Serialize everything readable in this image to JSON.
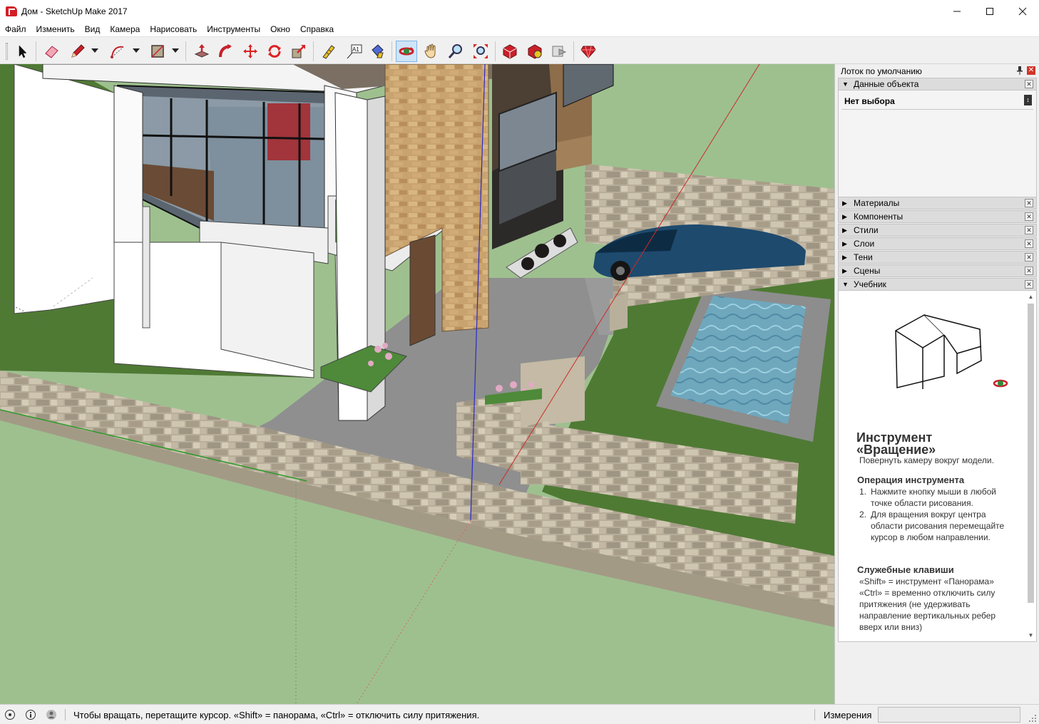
{
  "window": {
    "title": "Дом - SketchUp Make 2017",
    "minimize_symbol": "—",
    "maximize_symbol": "☐",
    "close_symbol": "✕"
  },
  "menu": [
    "Файл",
    "Изменить",
    "Вид",
    "Камера",
    "Нарисовать",
    "Инструменты",
    "Окно",
    "Справка"
  ],
  "toolbar": {
    "tools": [
      {
        "name": "select-tool",
        "icon": "arrow-cursor-icon"
      },
      {
        "name": "eraser-tool",
        "icon": "eraser-icon"
      },
      {
        "name": "line-tool",
        "icon": "pencil-icon"
      },
      {
        "name": "arc-tool",
        "icon": "arc-icon"
      },
      {
        "name": "shape-tool",
        "icon": "rectangle-icon"
      },
      {
        "name": "push-pull-tool",
        "icon": "push-pull-icon"
      },
      {
        "name": "follow-me-tool",
        "icon": "follow-me-icon"
      },
      {
        "name": "move-tool",
        "icon": "move-icon"
      },
      {
        "name": "rotate-tool",
        "icon": "rotate-icon"
      },
      {
        "name": "scale-tool",
        "icon": "scale-icon"
      },
      {
        "name": "tape-measure-tool",
        "icon": "tape-measure-icon"
      },
      {
        "name": "text-tool",
        "icon": "text-icon"
      },
      {
        "name": "paint-bucket-tool",
        "icon": "paint-bucket-icon"
      },
      {
        "name": "orbit-tool",
        "icon": "orbit-icon",
        "active": true
      },
      {
        "name": "pan-tool",
        "icon": "hand-icon"
      },
      {
        "name": "zoom-tool",
        "icon": "magnifier-icon"
      },
      {
        "name": "zoom-extents-tool",
        "icon": "zoom-extents-icon"
      },
      {
        "name": "3d-warehouse-button",
        "icon": "warehouse-icon"
      },
      {
        "name": "extension-warehouse-button",
        "icon": "extension-icon"
      },
      {
        "name": "send-to-layout-button",
        "icon": "layout-icon"
      },
      {
        "name": "ruby-console-button",
        "icon": "ruby-icon"
      }
    ],
    "text_tool_glyph": "A1"
  },
  "tray": {
    "title": "Лоток по умолчанию",
    "pin_symbol": "📌",
    "close_symbol": "✕",
    "entity_info": {
      "label": "Данные объекта",
      "expanded": true,
      "value": "Нет выбора",
      "button_glyph": "↕"
    },
    "panels": [
      {
        "label": "Материалы",
        "expanded": false
      },
      {
        "label": "Компоненты",
        "expanded": false
      },
      {
        "label": "Стили",
        "expanded": false
      },
      {
        "label": "Слои",
        "expanded": false
      },
      {
        "label": "Тени",
        "expanded": false
      },
      {
        "label": "Сцены",
        "expanded": false
      },
      {
        "label": "Учебник",
        "expanded": true
      }
    ],
    "collapsed_marker": "▶",
    "expanded_marker": "▼",
    "panel_close": "✕",
    "instructor": {
      "title_line1": "Инструмент",
      "title_line2": "«Вращение»",
      "subtitle": "Повернуть камеру вокруг модели.",
      "op_heading": "Операция инструмента",
      "steps": [
        {
          "n": "1.",
          "text": "Нажмите кнопку мыши в любой точке области рисования."
        },
        {
          "n": "2.",
          "text": "Для вращения вокруг центра области рисования перемещайте курсор в любом направлении."
        }
      ],
      "keys_heading": "Служебные клавиши",
      "keys_text": "«Shift» = инструмент «Панорама» «Ctrl» = временно отключить силу притяжения (не удерживать направление вертикальных ребер вверх или вниз)",
      "scroll_up": "▲",
      "scroll_down": "▼"
    }
  },
  "status": {
    "hint": "Чтобы вращать, перетащите курсор. «Shift» = панорама, «Ctrl» = отключить силу притяжения.",
    "measurements_label": "Измерения",
    "measurements_value": ""
  },
  "colors": {
    "accent_active_tool": "#cfe4f7",
    "grass": "#9ec08f",
    "lawn": "#4f7a34",
    "red_axis": "#cc2a2a",
    "green_axis": "#2a9a2a",
    "blue_axis": "#2a2acc"
  }
}
